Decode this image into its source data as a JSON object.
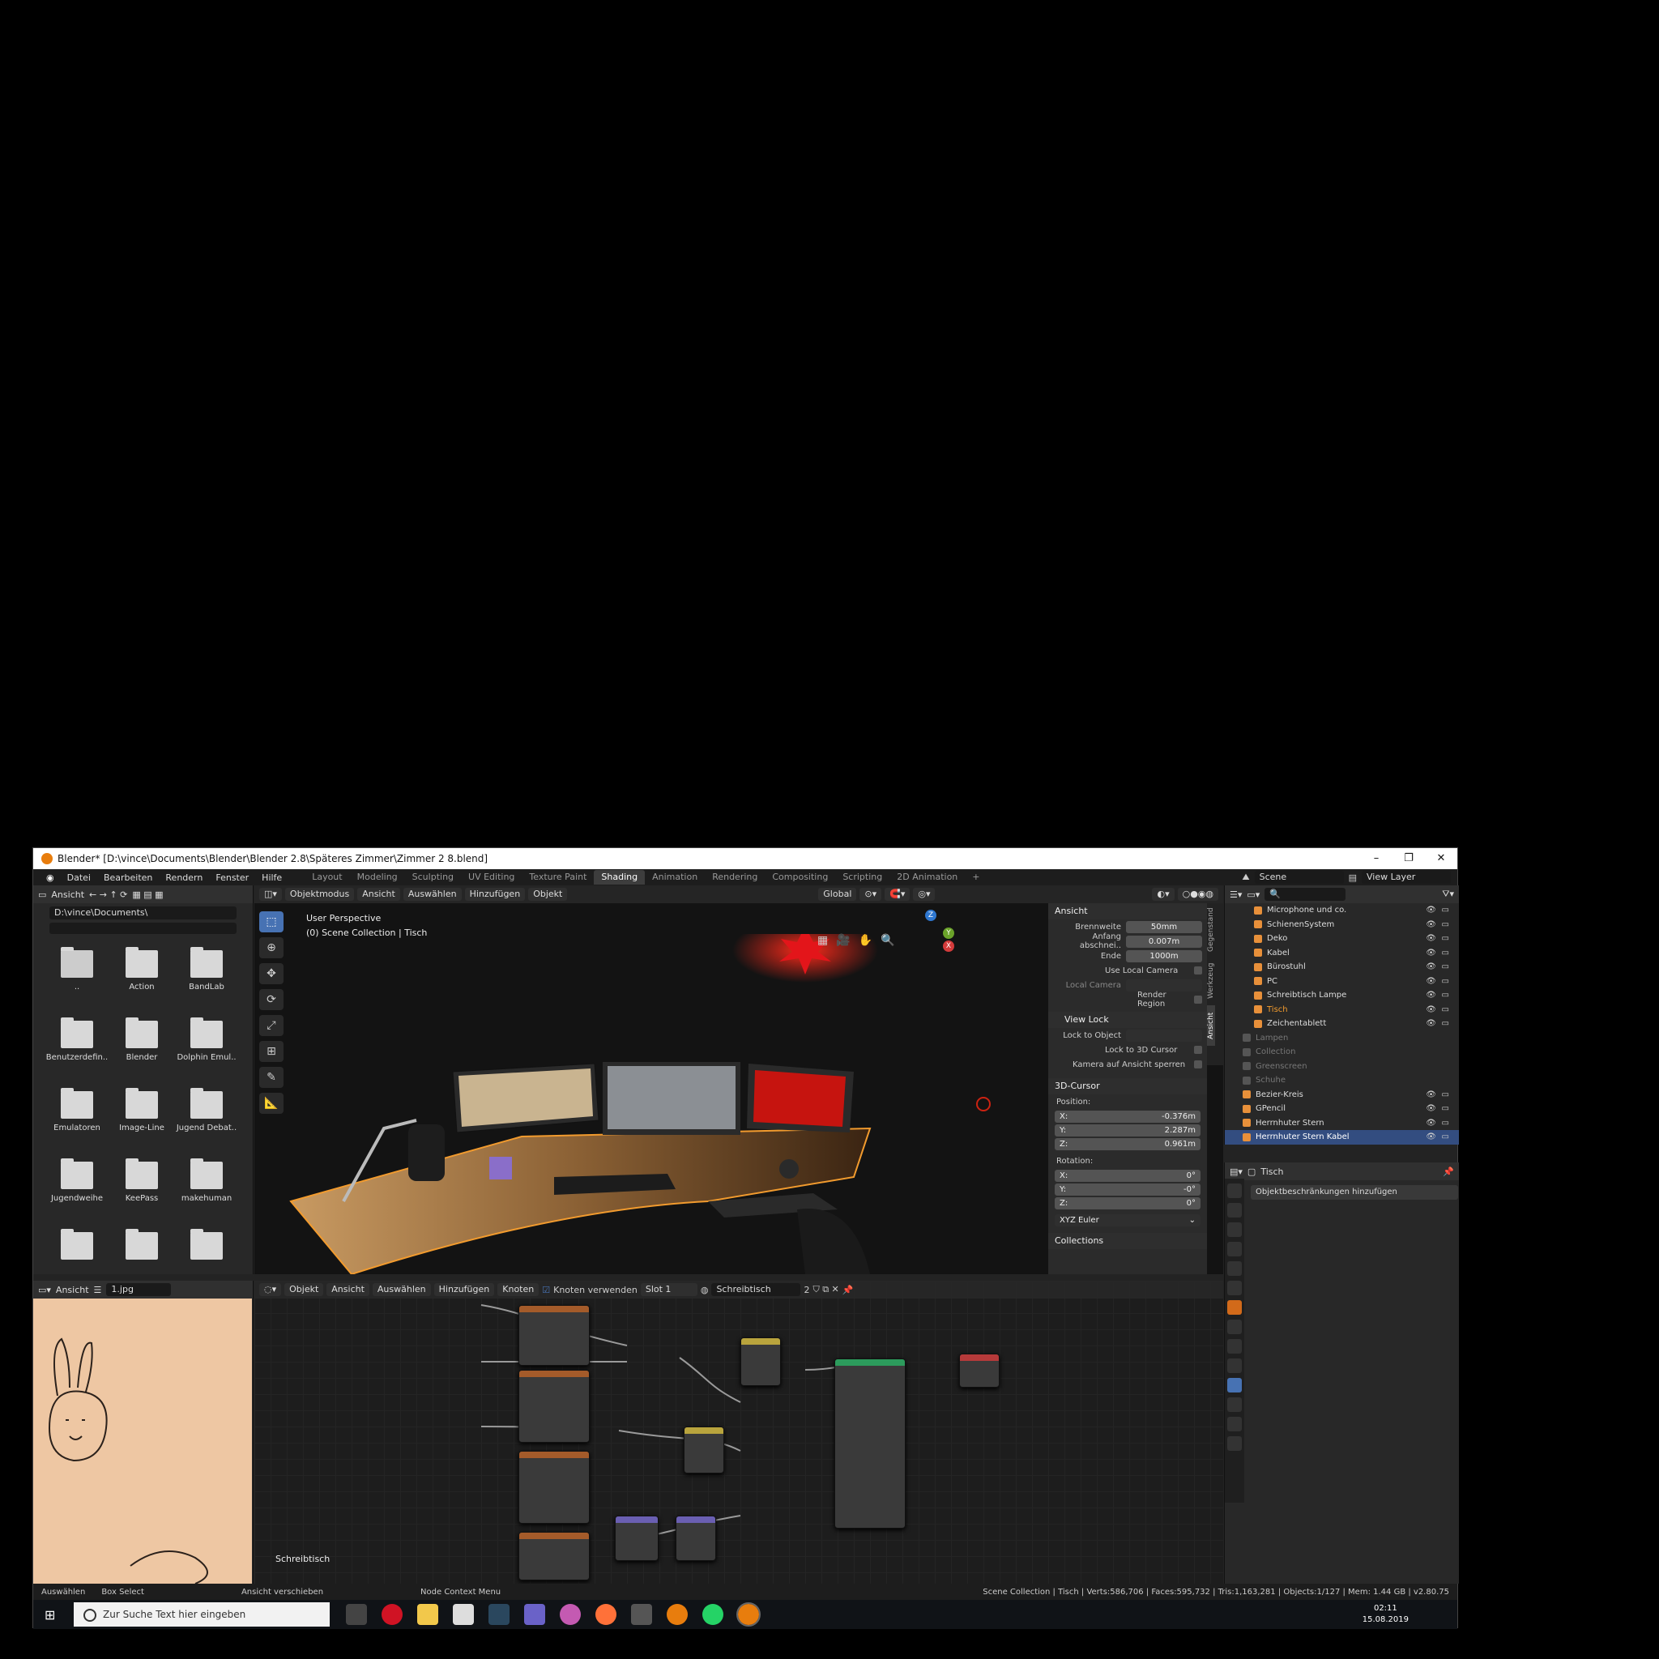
{
  "window": {
    "title": "Blender* [D:\\vince\\Documents\\Blender\\Blender 2.8\\Späteres Zimmer\\Zimmer 2 8.blend]",
    "minimize": "–",
    "maximize": "❐",
    "close": "✕"
  },
  "menubar": {
    "items": [
      "Datei",
      "Bearbeiten",
      "Rendern",
      "Fenster",
      "Hilfe"
    ],
    "workspaces": [
      "Layout",
      "Modeling",
      "Sculpting",
      "UV Editing",
      "Texture Paint",
      "Shading",
      "Animation",
      "Rendering",
      "Compositing",
      "Scripting",
      "2D Animation"
    ],
    "active_workspace": "Shading",
    "scene": "Scene",
    "view_layer": "View Layer"
  },
  "file_browser": {
    "view_label": "Ansicht",
    "path": "D:\\vince\\Documents\\",
    "items": [
      "..",
      "Action",
      "BandLab",
      "Benutzerdefin..",
      "Blender",
      "Dolphin Emul..",
      "Emulatoren",
      "Image-Line",
      "Jugend Debat..",
      "Jugendweihe",
      "KeePass",
      "makehuman",
      "",
      "",
      ""
    ]
  },
  "viewport": {
    "mode": "Objektmodus",
    "menus": [
      "Ansicht",
      "Auswählen",
      "Hinzufügen",
      "Objekt"
    ],
    "orientation": "Global",
    "perspective": "User Perspective",
    "collection_info": "(0) Scene Collection | Tisch",
    "gizmo_z": "Z",
    "gizmo_y": "Y",
    "gizmo_x": "X"
  },
  "npanel": {
    "section_view": "Ansicht",
    "brennweite_label": "Brennweite",
    "brennweite": "50mm",
    "clip_start_label": "Anfang abschnei..",
    "clip_start": "0.007m",
    "clip_end_label": "Ende",
    "clip_end": "1000m",
    "use_local_camera": "Use Local Camera",
    "local_camera": "Local Camera",
    "render_region": "Render Region",
    "view_lock": "View Lock",
    "lock_to_object": "Lock to Object",
    "lock_to_cursor": "Lock to 3D Cursor",
    "kamera_lock": "Kamera auf Ansicht sperren",
    "cursor_section": "3D-Cursor",
    "position": "Position:",
    "px": "-0.376m",
    "py": "2.287m",
    "pz": "0.961m",
    "rotation": "Rotation:",
    "rx": "0°",
    "ry": "-0°",
    "rz": "0°",
    "euler": "XYZ Euler",
    "collections": "Collections",
    "tabs": [
      "Gegenstand",
      "Werkzeug",
      "Ansicht"
    ]
  },
  "outliner": {
    "rows": [
      {
        "label": "Microphone und co.",
        "state": "normal"
      },
      {
        "label": "SchienenSystem",
        "state": "normal"
      },
      {
        "label": "Deko",
        "state": "normal"
      },
      {
        "label": "Kabel",
        "state": "normal"
      },
      {
        "label": "Bürostuhl",
        "state": "normal"
      },
      {
        "label": "PC",
        "state": "normal"
      },
      {
        "label": "Schreibtisch Lampe",
        "state": "normal"
      },
      {
        "label": "Tisch",
        "state": "active"
      },
      {
        "label": "Zeichentablett",
        "state": "normal"
      },
      {
        "label": "Lampen",
        "state": "dim"
      },
      {
        "label": "Collection",
        "state": "dim"
      },
      {
        "label": "Greenscreen",
        "state": "dim"
      },
      {
        "label": "Schuhe",
        "state": "dim"
      },
      {
        "label": "Bezier-Kreis",
        "state": "normal"
      },
      {
        "label": "GPencil",
        "state": "normal"
      },
      {
        "label": "Herrnhuter Stern",
        "state": "normal"
      },
      {
        "label": "Herrnhuter Stern Kabel",
        "state": "selected"
      }
    ]
  },
  "properties": {
    "object": "Tisch",
    "add_constraint": "Objektbeschränkungen hinzufügen"
  },
  "image_editor": {
    "view_label": "Ansicht",
    "image_name": "1.jpg"
  },
  "node_editor": {
    "mode": "Objekt",
    "menus": [
      "Ansicht",
      "Auswählen",
      "Hinzufügen",
      "Knoten"
    ],
    "use_nodes": "Knoten verwenden",
    "slot": "Slot 1",
    "material": "Schreibtisch",
    "users": "2",
    "canvas_label": "Schreibtisch"
  },
  "statusbar": {
    "select": "Auswählen",
    "box_select": "Box Select",
    "pan": "Ansicht verschieben",
    "context": "Node Context Menu",
    "stats": "Scene Collection | Tisch | Verts:586,706 | Faces:595,732 | Tris:1,163,281 | Objects:1/127 | Mem: 1.44 GB | v2.80.75"
  },
  "taskbar": {
    "search_placeholder": "Zur Suche Text hier eingeben",
    "time": "02:11",
    "date": "15.08.2019"
  },
  "colors": {
    "accent": "#4772b3",
    "active_tab": "#3d3d3d",
    "selection_orange": "#f29b2e",
    "red_glow": "#d8121b"
  }
}
